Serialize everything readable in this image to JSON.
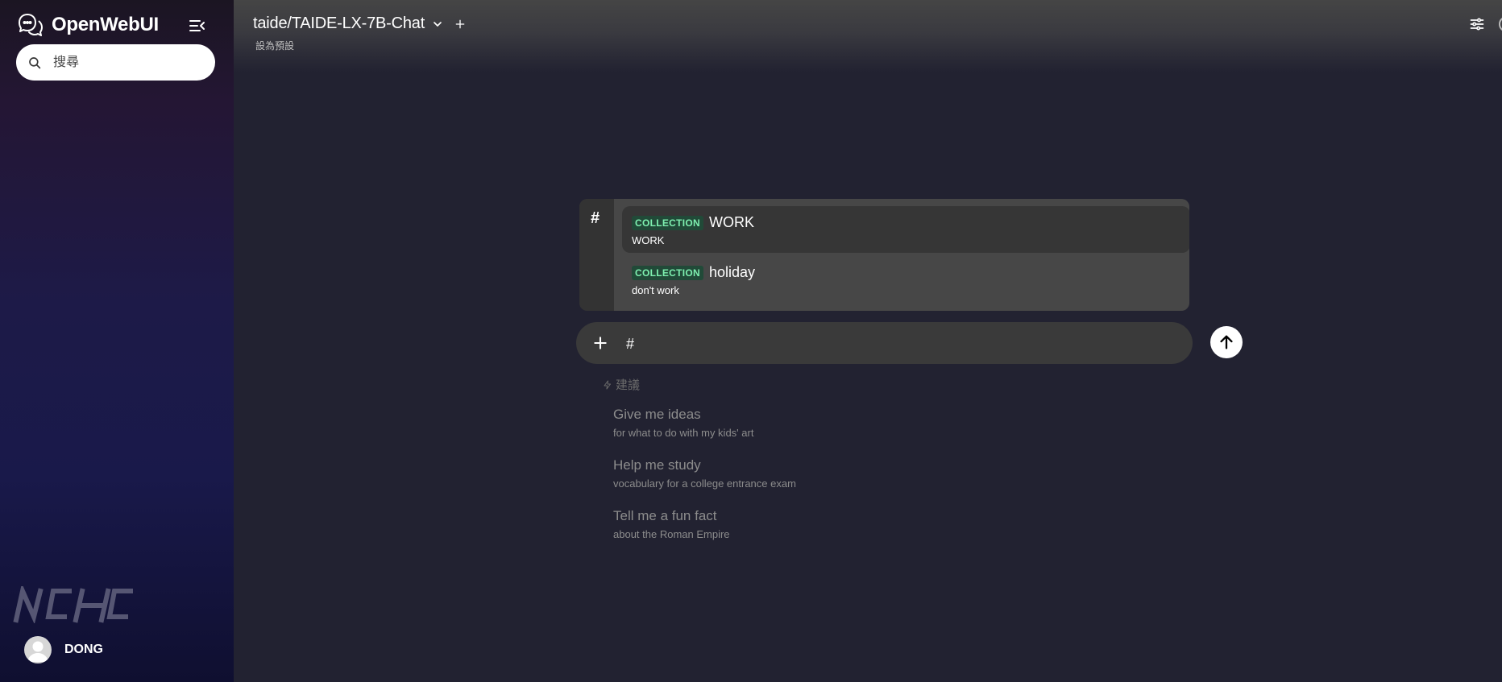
{
  "sidebar": {
    "brand": "OpenWebUI",
    "search": {
      "placeholder": "搜尋"
    },
    "user": {
      "name": "DONG"
    },
    "footer_logo": "NCHC"
  },
  "header": {
    "model_name": "taide/TAIDE-LX-7B-Chat",
    "set_default": "設為預設"
  },
  "collections_popup": {
    "trigger": "#",
    "items": [
      {
        "badge": "COLLECTION",
        "name": "WORK",
        "description": "WORK",
        "selected": true
      },
      {
        "badge": "COLLECTION",
        "name": "holiday",
        "description": "don't work",
        "selected": false
      }
    ]
  },
  "input": {
    "value": "#"
  },
  "suggestions": {
    "label": "建議",
    "items": [
      {
        "title": "Give me ideas",
        "subtitle": "for what to do with my kids' art"
      },
      {
        "title": "Help me study",
        "subtitle": "vocabulary for a college entrance exam"
      },
      {
        "title": "Tell me a fun fact",
        "subtitle": "about the Roman Empire"
      }
    ]
  },
  "colors": {
    "badge_text": "#7ef0b0",
    "badge_bg": "#214a38",
    "sidebar_gradient_top": "#241634",
    "sidebar_gradient_bottom": "#0f0f30"
  },
  "icons": [
    "chat-bubbles-logo-icon",
    "collapse-sidebar-icon",
    "search-icon",
    "chevron-down-icon",
    "plus-icon",
    "sliders-icon",
    "account-icon",
    "arrow-up-icon",
    "bolt-icon",
    "user-avatar-icon"
  ]
}
